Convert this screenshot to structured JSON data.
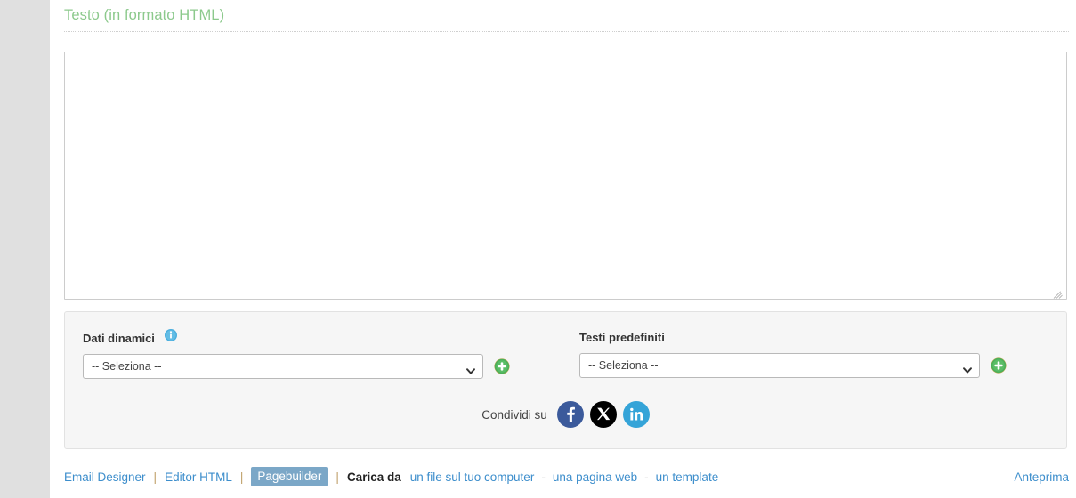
{
  "section": {
    "title": "Testo (in formato HTML)"
  },
  "editor": {
    "textarea_value": "",
    "textarea_placeholder": ""
  },
  "panel": {
    "dynamic_data": {
      "label": "Dati dinamici",
      "info_icon": "info-circle-icon",
      "select_value": "-- Seleziona --",
      "add_icon": "plus-circle-icon"
    },
    "predefined_texts": {
      "label": "Testi predefiniti",
      "select_value": "-- Seleziona --",
      "add_icon": "plus-circle-icon"
    },
    "share": {
      "label": "Condividi su",
      "networks": [
        {
          "name": "facebook",
          "glyph": "f",
          "color": "#3b5a9b"
        },
        {
          "name": "x-twitter",
          "glyph": "X",
          "color": "#000000"
        },
        {
          "name": "linkedin",
          "glyph": "in",
          "color": "#35a4d8"
        }
      ]
    }
  },
  "toolbar": {
    "email_designer": "Email Designer",
    "editor_html": "Editor HTML",
    "pagebuilder": "Pagebuilder",
    "separator": "|",
    "carica_da": "Carica da",
    "dash": "-",
    "upload_computer": "un file sul tuo computer",
    "upload_webpage": "una pagina web",
    "upload_template": "un template",
    "preview": "Anteprima"
  },
  "colors": {
    "heading_green": "#8cc98c",
    "link_blue": "#3d8ecc",
    "active_tab_bg": "#7ba7c7",
    "add_green": "#4caf50",
    "info_blue": "#4aaede"
  }
}
